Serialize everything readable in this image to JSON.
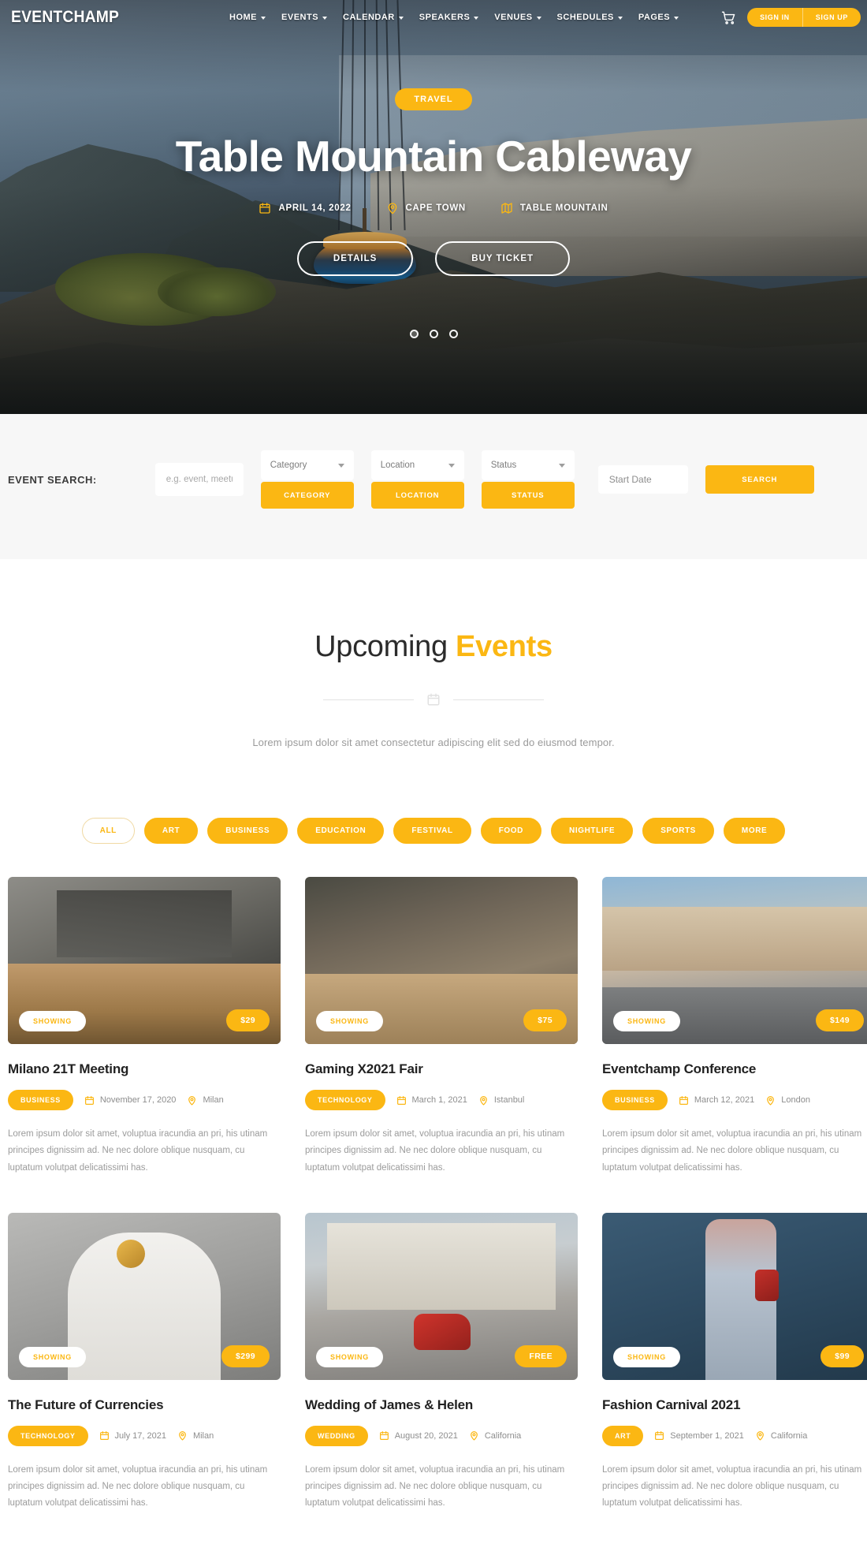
{
  "nav": {
    "brand": "EVENTCHAMP",
    "items": [
      {
        "label": "HOME",
        "has_caret": true
      },
      {
        "label": "EVENTS",
        "has_caret": true
      },
      {
        "label": "CALENDAR",
        "has_caret": true
      },
      {
        "label": "SPEAKERS",
        "has_caret": true
      },
      {
        "label": "VENUES",
        "has_caret": true
      },
      {
        "label": "SCHEDULES",
        "has_caret": true
      },
      {
        "label": "PAGES",
        "has_caret": true
      }
    ],
    "cart_icon": "shopping-cart-icon",
    "sign_in": "SIGN IN",
    "sign_up": "SIGN UP",
    "accent": "#fbb713"
  },
  "hero": {
    "badge": "TRAVEL",
    "title": "Table Mountain Cableway",
    "meta": [
      {
        "icon": "calendar-icon",
        "text": "APRIL 14, 2022"
      },
      {
        "icon": "location-pin-icon",
        "text": "CAPE TOWN"
      },
      {
        "icon": "map-icon",
        "text": "TABLE MOUNTAIN"
      }
    ],
    "details_button": "DETAILS",
    "ticket_button": "BUY TICKET",
    "slides": 3,
    "active_slide": 1
  },
  "search": {
    "label": "EVENT SEARCH:",
    "keyword_placeholder": "e.g. event, meetup",
    "keyword_value": "",
    "category_select": "Category",
    "category_button": "CATEGORY",
    "location_select": "Location",
    "location_button": "LOCATION",
    "status_select": "Status",
    "status_button": "STATUS",
    "date_placeholder": "Start Date",
    "date_value": "",
    "search_button": "SEARCH"
  },
  "events_section": {
    "title_plain": "Upcoming ",
    "title_highlight": "Events",
    "divider_icon": "calendar-icon",
    "subtitle": "Lorem ipsum dolor sit amet consectetur adipiscing elit sed do eiusmod tempor.",
    "filters": [
      {
        "label": "ALL",
        "active": true
      },
      {
        "label": "ART",
        "active": false
      },
      {
        "label": "BUSINESS",
        "active": false
      },
      {
        "label": "EDUCATION",
        "active": false
      },
      {
        "label": "FESTIVAL",
        "active": false
      },
      {
        "label": "FOOD",
        "active": false
      },
      {
        "label": "NIGHTLIFE",
        "active": false
      },
      {
        "label": "SPORTS",
        "active": false
      },
      {
        "label": "MORE",
        "active": false
      }
    ],
    "description": "Lorem ipsum dolor sit amet, voluptua iracundia an pri, his utinam principes dignissim ad. Ne nec dolore oblique nusquam, cu luptatum volutpat delicatissimi has.",
    "cards": [
      {
        "status": "SHOWING",
        "price": "$29",
        "title": "Milano 21T Meeting",
        "tag": "BUSINESS",
        "date": "November 17, 2020",
        "location": "Milan",
        "scene": "img-office"
      },
      {
        "status": "SHOWING",
        "price": "$75",
        "title": "Gaming X2021 Fair",
        "tag": "TECHNOLOGY",
        "date": "March 1, 2021",
        "location": "Istanbul",
        "scene": "img-meeting"
      },
      {
        "status": "SHOWING",
        "price": "$149",
        "title": "Eventchamp Conference",
        "tag": "BUSINESS",
        "date": "March 12, 2021",
        "location": "London",
        "scene": "img-street"
      },
      {
        "status": "SHOWING",
        "price": "$299",
        "title": "The Future of Currencies",
        "tag": "TECHNOLOGY",
        "date": "July 17, 2021",
        "location": "Milan",
        "scene": "img-coin"
      },
      {
        "status": "SHOWING",
        "price": "FREE",
        "title": "Wedding of James & Helen",
        "tag": "WEDDING",
        "date": "August 20, 2021",
        "location": "California",
        "scene": "img-vespa"
      },
      {
        "status": "SHOWING",
        "price": "$99",
        "title": "Fashion Carnival 2021",
        "tag": "ART",
        "date": "September 1, 2021",
        "location": "California",
        "scene": "img-fashion"
      }
    ]
  }
}
